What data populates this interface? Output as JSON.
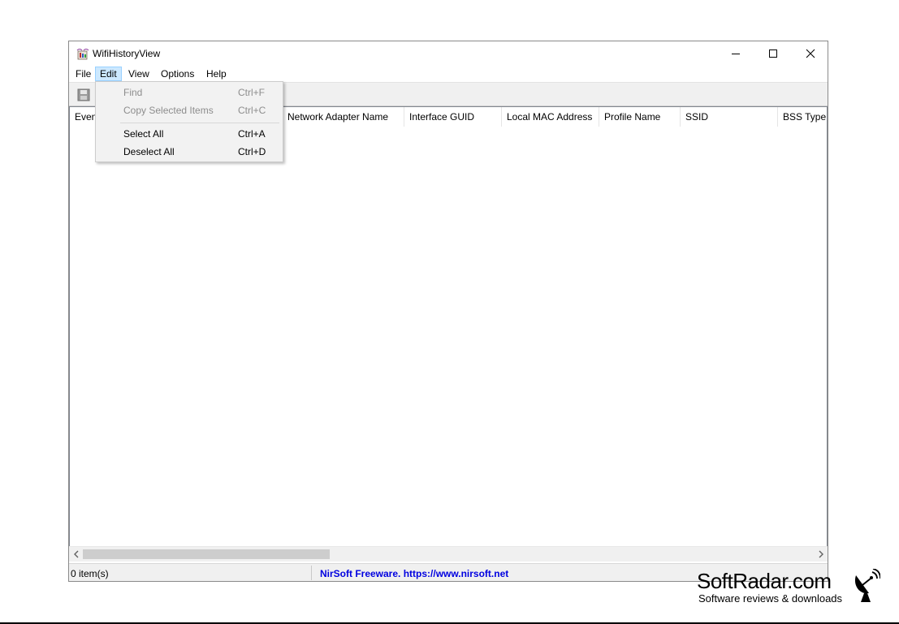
{
  "window": {
    "title": "WifiHistoryView"
  },
  "menubar": {
    "items": [
      {
        "label": "File"
      },
      {
        "label": "Edit",
        "active": true
      },
      {
        "label": "View"
      },
      {
        "label": "Options"
      },
      {
        "label": "Help"
      }
    ]
  },
  "edit_menu": {
    "items": [
      {
        "label": "Find",
        "shortcut": "Ctrl+F",
        "enabled": false
      },
      {
        "label": "Copy Selected Items",
        "shortcut": "Ctrl+C",
        "enabled": false
      },
      {
        "label": "Select All",
        "shortcut": "Ctrl+A",
        "enabled": true
      },
      {
        "label": "Deselect All",
        "shortcut": "Ctrl+D",
        "enabled": true
      }
    ]
  },
  "list": {
    "columns": [
      {
        "label": "Even"
      },
      {
        "label": "Network Adapter Name"
      },
      {
        "label": "Interface GUID"
      },
      {
        "label": "Local MAC Address"
      },
      {
        "label": "Profile Name"
      },
      {
        "label": "SSID"
      },
      {
        "label": "BSS Type"
      }
    ],
    "rows": []
  },
  "statusbar": {
    "item_count": "0 item(s)",
    "link_text": "NirSoft Freeware. https://www.nirsoft.net"
  },
  "watermark": {
    "brand": "SoftRadar.com",
    "tagline": "Software reviews & downloads"
  },
  "colors": {
    "menu_active_bg": "#cce8ff",
    "link": "#0000e0",
    "disabled_text": "#8d8d8d"
  }
}
